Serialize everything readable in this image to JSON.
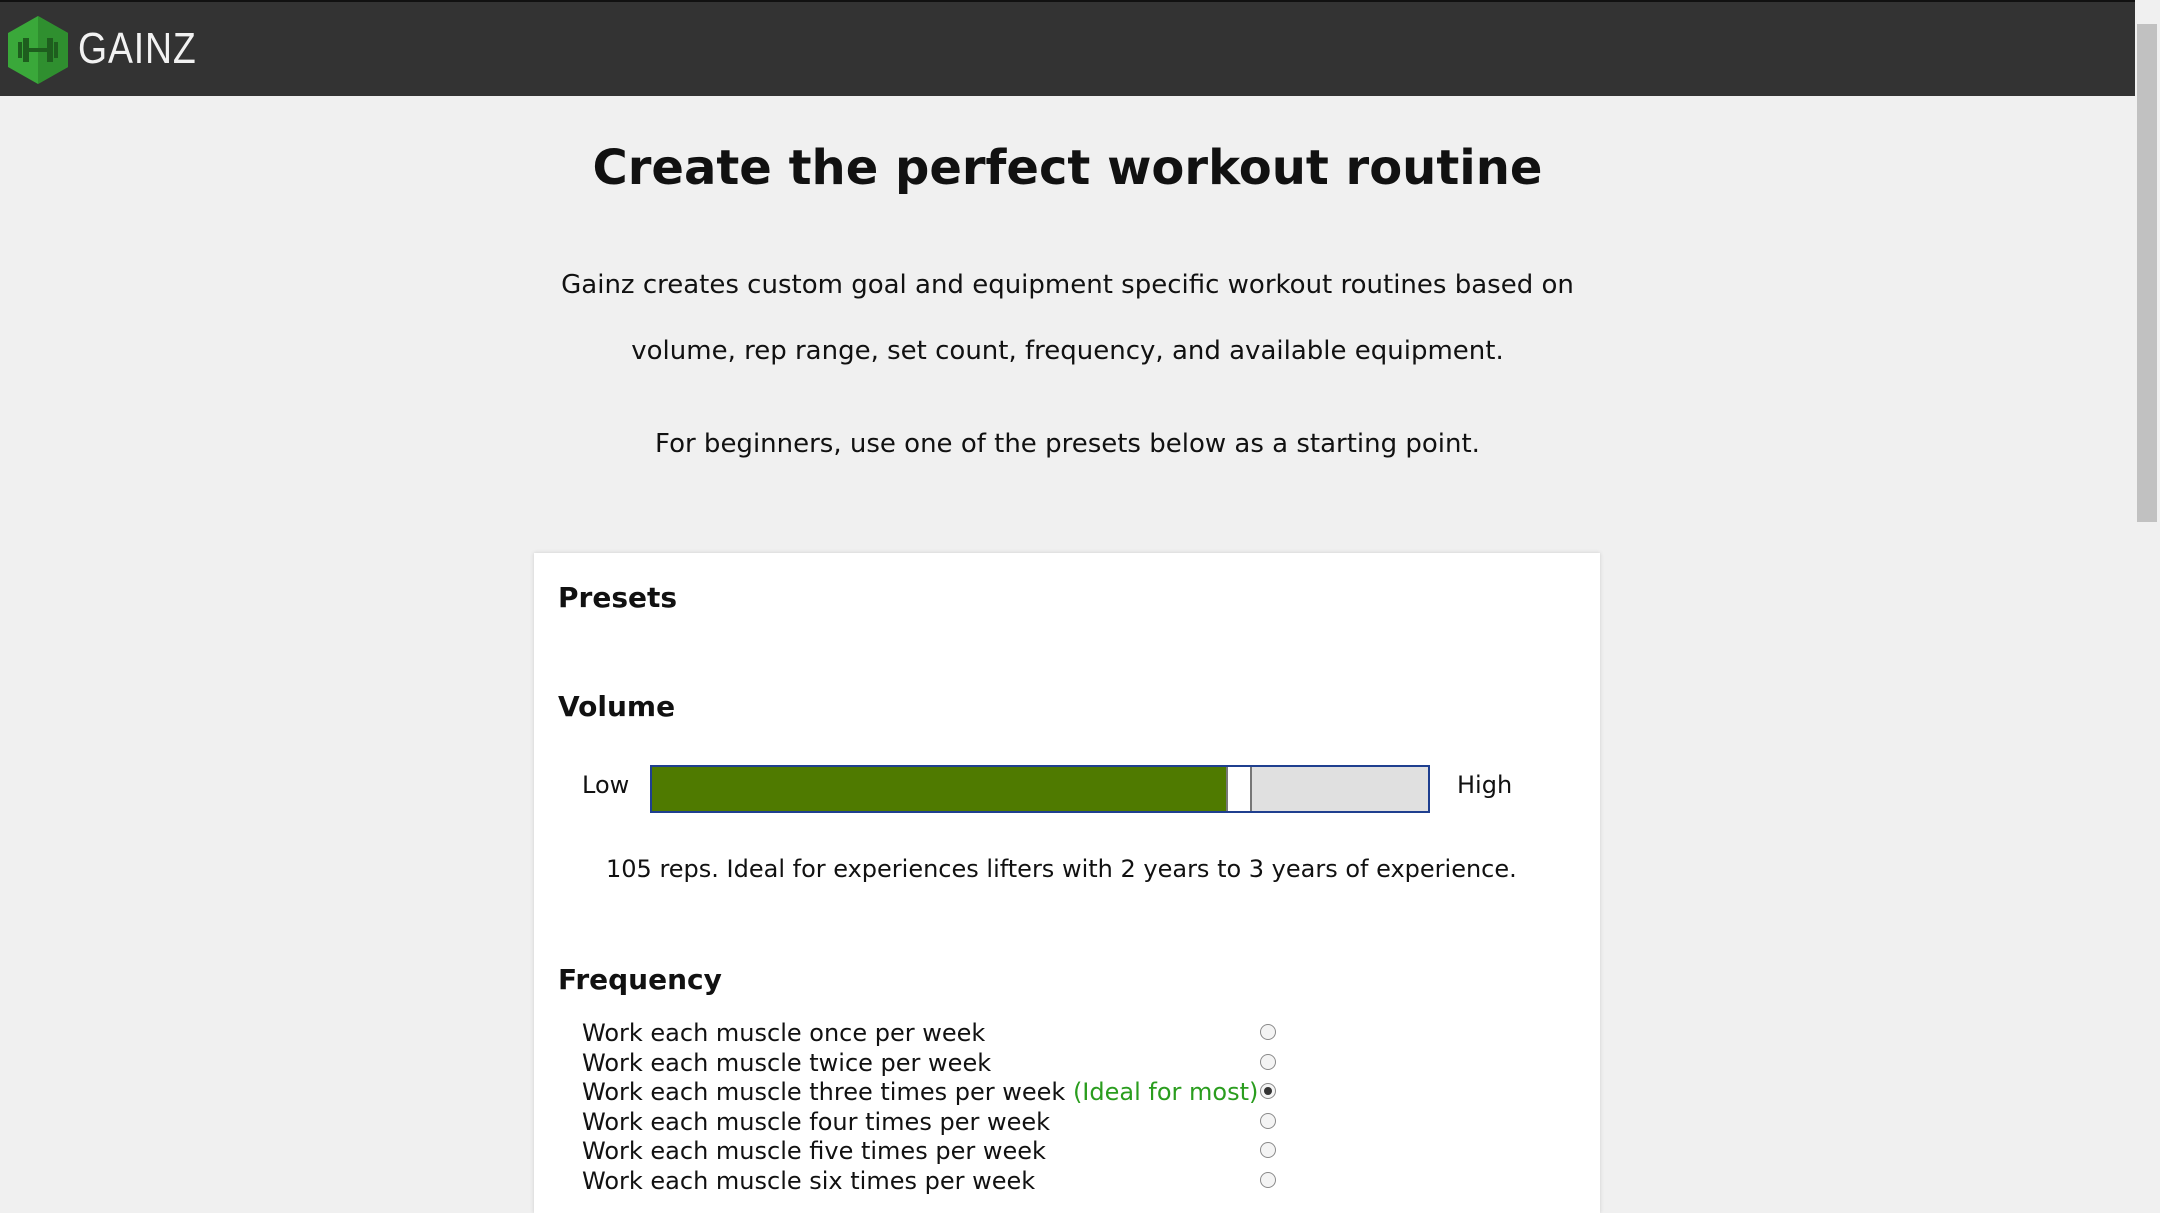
{
  "header": {
    "brand": "GAINZ",
    "logo_icon": "dumbbell-icon",
    "accent": "#3aa83a"
  },
  "hero": {
    "title": "Create the perfect workout routine",
    "line1": "Gainz creates custom goal and equipment specific workout routines based on",
    "line2": "volume, rep range, set count, frequency, and available equipment.",
    "line3": "For beginners, use one of the presets below as a starting point."
  },
  "card": {
    "presets_title": "Presets",
    "volume": {
      "title": "Volume",
      "low_label": "Low",
      "high_label": "High",
      "level": 0.74,
      "fill_color": "#4f7a00",
      "description": "105 reps. Ideal for experiences lifters with 2 years to 3 years of experience."
    },
    "frequency": {
      "title": "Frequency",
      "options": [
        {
          "label": "Work each muscle once per week",
          "note": "",
          "checked": false
        },
        {
          "label": "Work each muscle twice per week",
          "note": "",
          "checked": false
        },
        {
          "label": "Work each muscle three times per week",
          "note": "(Ideal for most)",
          "checked": true
        },
        {
          "label": "Work each muscle four times per week",
          "note": "",
          "checked": false
        },
        {
          "label": "Work each muscle five times per week",
          "note": "",
          "checked": false
        },
        {
          "label": "Work each muscle six times per week",
          "note": "",
          "checked": false
        }
      ]
    }
  }
}
